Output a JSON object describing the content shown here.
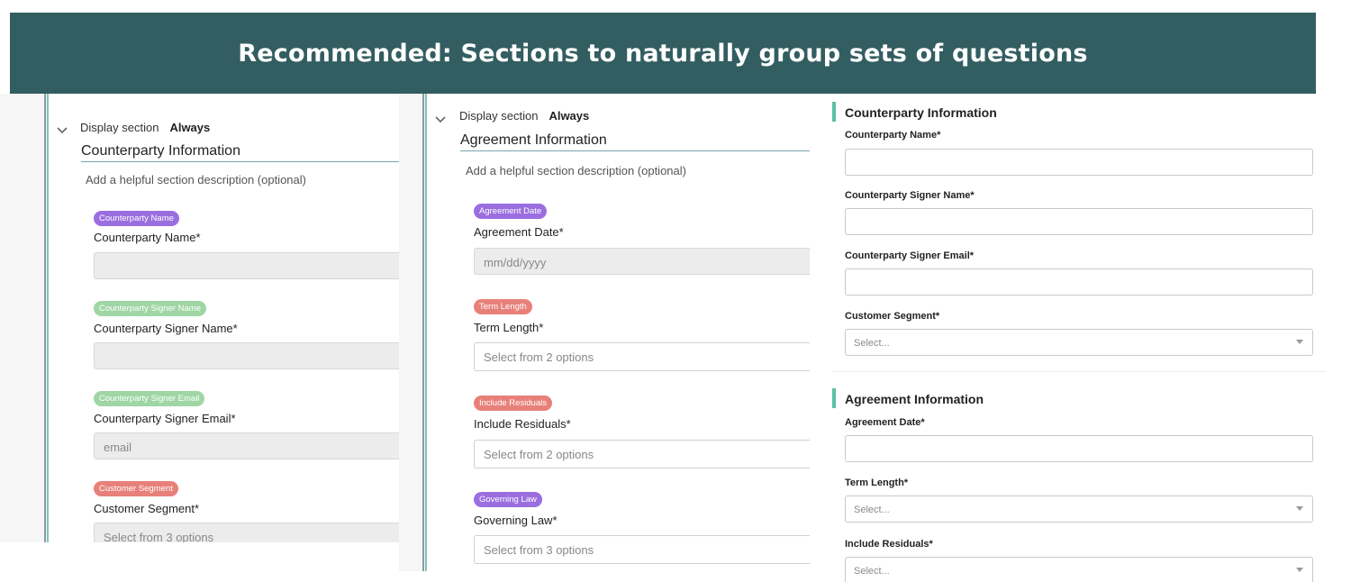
{
  "banner": {
    "title": "Recommended: Sections to naturally group sets of questions"
  },
  "editor_left": {
    "display_label": "Display section",
    "display_value": "Always",
    "section_title": "Counterparty Information",
    "description_placeholder": "Add a helpful section description (optional)",
    "questions": [
      {
        "tag": "Counterparty Name",
        "tag_color": "#9b6ee0",
        "label": "Counterparty Name*",
        "placeholder": ""
      },
      {
        "tag": "Counterparty Signer Name",
        "tag_color": "#9fd6a4",
        "label": "Counterparty Signer Name*",
        "placeholder": ""
      },
      {
        "tag": "Counterparty Signer Email",
        "tag_color": "#9fd6a4",
        "label": "Counterparty Signer Email*",
        "placeholder": "email"
      },
      {
        "tag": "Customer Segment",
        "tag_color": "#e8807a",
        "label": "Customer Segment*",
        "placeholder": "Select from 3 options"
      }
    ]
  },
  "editor_right": {
    "display_label": "Display section",
    "display_value": "Always",
    "section_title": "Agreement Information",
    "description_placeholder": "Add a helpful section description (optional)",
    "questions": [
      {
        "tag": "Agreement Date",
        "tag_color": "#9b6ee0",
        "label": "Agreement Date*",
        "placeholder": "mm/dd/yyyy"
      },
      {
        "tag": "Term Length",
        "tag_color": "#e8807a",
        "label": "Term Length*",
        "placeholder": "Select from 2 options"
      },
      {
        "tag": "Include Residuals",
        "tag_color": "#e8807a",
        "label": "Include Residuals*",
        "placeholder": "Select from 2 options"
      },
      {
        "tag": "Governing Law",
        "tag_color": "#9b6ee0",
        "label": "Governing Law*",
        "placeholder": "Select from 3 options"
      }
    ]
  },
  "preview": {
    "accent_color": "#5bbfa8",
    "sections": [
      {
        "title": "Counterparty Information",
        "fields": [
          {
            "label": "Counterparty Name*",
            "type": "text",
            "value": ""
          },
          {
            "label": "Counterparty Signer Name*",
            "type": "text",
            "value": ""
          },
          {
            "label": "Counterparty Signer Email*",
            "type": "text",
            "value": ""
          },
          {
            "label": "Customer Segment*",
            "type": "select",
            "value": "Select..."
          }
        ]
      },
      {
        "title": "Agreement Information",
        "fields": [
          {
            "label": "Agreement Date*",
            "type": "text",
            "value": ""
          },
          {
            "label": "Term Length*",
            "type": "select",
            "value": "Select..."
          },
          {
            "label": "Include Residuals*",
            "type": "select",
            "value": "Select..."
          }
        ]
      }
    ]
  },
  "colors": {
    "banner": "#335e61",
    "tag_purple": "#9b6ee0",
    "tag_green": "#9fd6a4",
    "tag_red": "#e8807a"
  }
}
